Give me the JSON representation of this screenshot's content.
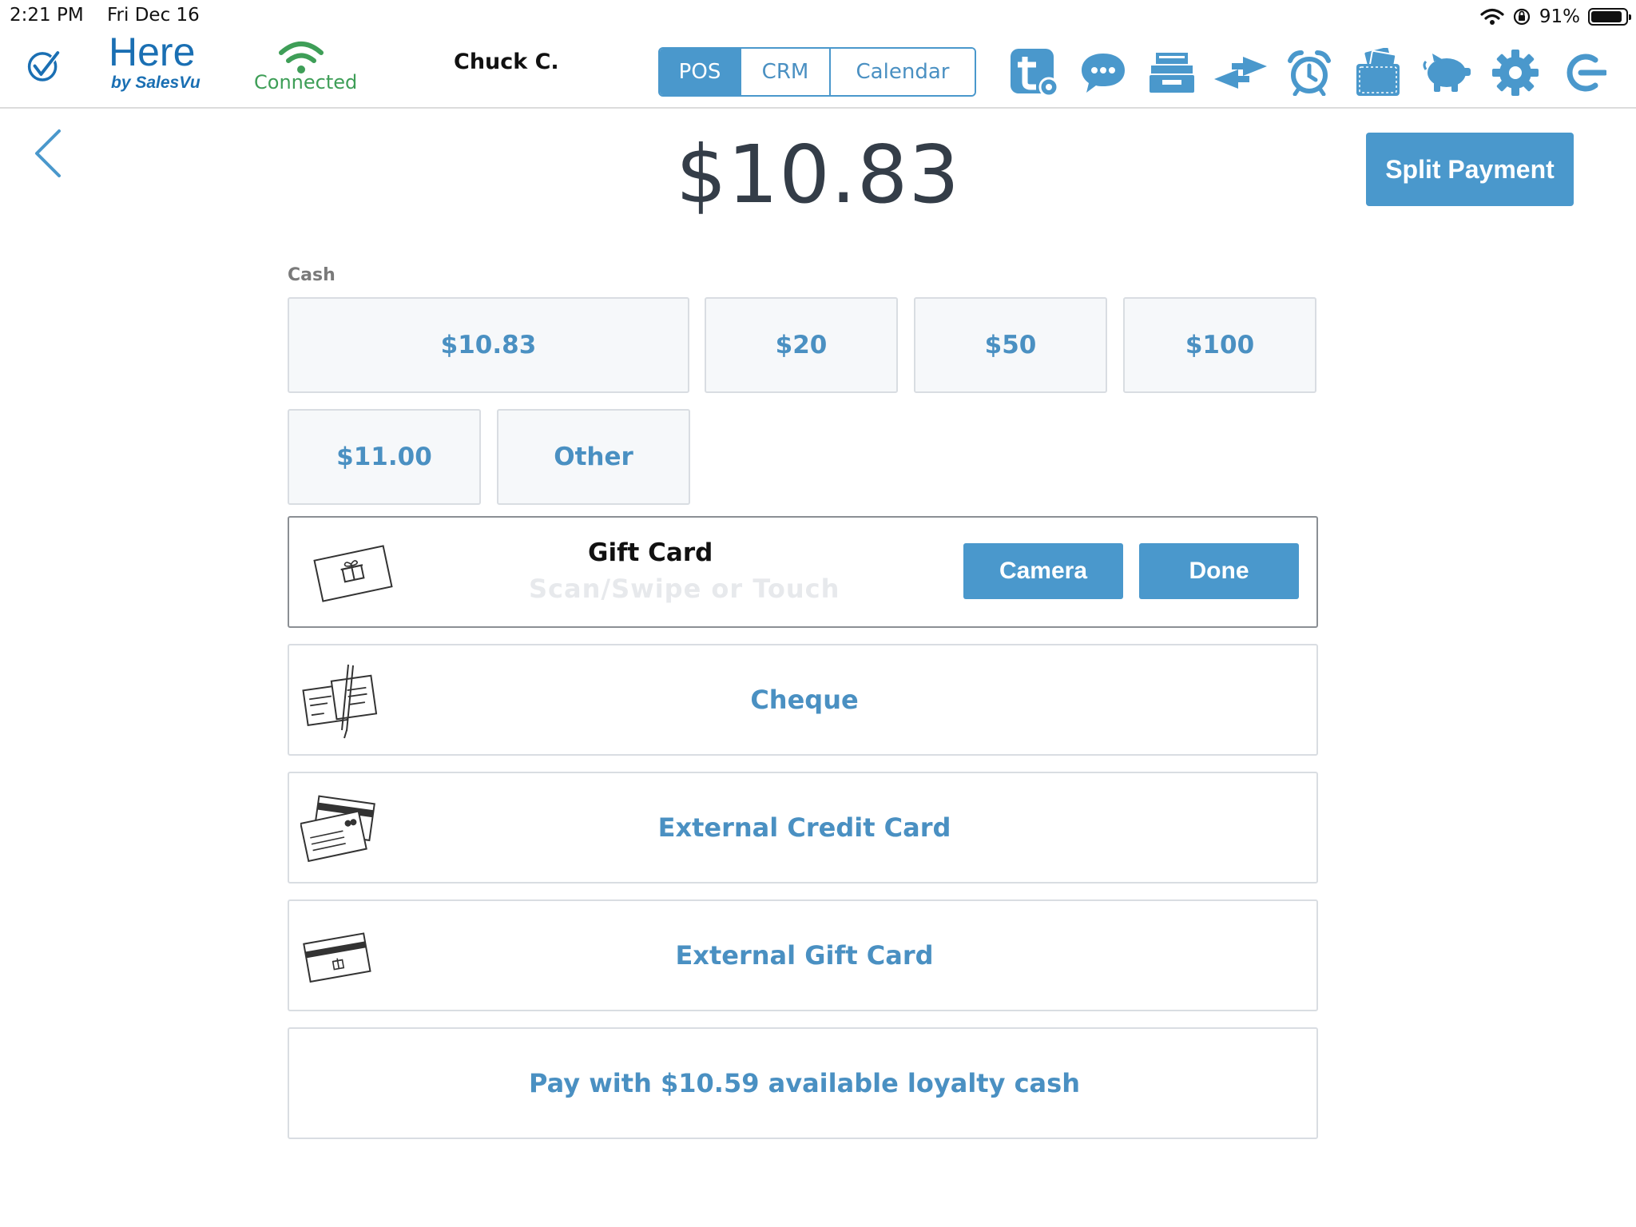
{
  "status_bar": {
    "time": "2:21 PM",
    "date": "Fri Dec 16",
    "battery": "91%",
    "battery_level": 0.91
  },
  "header": {
    "logo_main": "Here",
    "logo_sub": "by SalesVu",
    "connection_status": "Connected",
    "user_name": "Chuck C.",
    "tabs": [
      {
        "label": "POS",
        "active": true
      },
      {
        "label": "CRM",
        "active": false
      },
      {
        "label": "Calendar",
        "active": false
      }
    ],
    "toolbar_icons": [
      "timesheet-settings-icon",
      "chat-icon",
      "cash-drawer-icon",
      "transfer-arrows-icon",
      "alarm-clock-icon",
      "wallet-icon",
      "piggy-bank-icon",
      "gear-icon",
      "logout-icon"
    ]
  },
  "payment": {
    "total": "$10.83",
    "split_label": "Split Payment",
    "cash_label": "Cash",
    "cash_options": [
      "$10.83",
      "$20",
      "$50",
      "$100",
      "$11.00",
      "Other"
    ],
    "gift_card": {
      "title": "Gift Card",
      "placeholder": "Scan/Swipe or Touch",
      "camera_label": "Camera",
      "done_label": "Done"
    },
    "methods": {
      "cheque": "Cheque",
      "external_credit": "External Credit Card",
      "external_gift": "External Gift Card",
      "loyalty": "Pay with $10.59 available loyalty cash"
    }
  },
  "colors": {
    "accent": "#4a98cc",
    "text_dark": "#343d48",
    "connected": "#3e9e57",
    "logo_blue": "#1a6fb3"
  }
}
